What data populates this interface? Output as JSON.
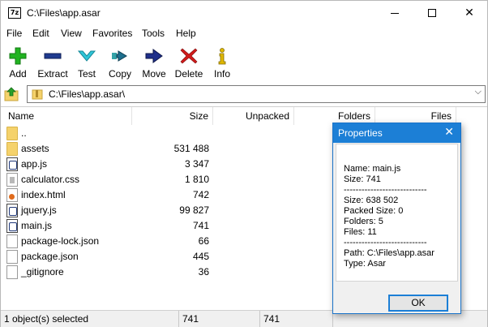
{
  "window": {
    "title": "C:\\Files\\app.asar",
    "app_icon_text": "7z"
  },
  "menu": [
    "File",
    "Edit",
    "View",
    "Favorites",
    "Tools",
    "Help"
  ],
  "toolbar": {
    "add": "Add",
    "extract": "Extract",
    "test": "Test",
    "copy": "Copy",
    "move": "Move",
    "delete": "Delete",
    "info": "Info"
  },
  "address": {
    "path": "C:\\Files\\app.asar\\"
  },
  "columns": {
    "name": "Name",
    "size": "Size",
    "unpacked": "Unpacked",
    "folders": "Folders",
    "files": "Files"
  },
  "rows": [
    {
      "name": "..",
      "size": "",
      "icon": "folder"
    },
    {
      "name": "assets",
      "size": "531 488",
      "icon": "folder"
    },
    {
      "name": "app.js",
      "size": "3 347",
      "icon": "script"
    },
    {
      "name": "calculator.css",
      "size": "1 810",
      "icon": "css"
    },
    {
      "name": "index.html",
      "size": "742",
      "icon": "html"
    },
    {
      "name": "jquery.js",
      "size": "99 827",
      "icon": "script"
    },
    {
      "name": "main.js",
      "size": "741",
      "icon": "script"
    },
    {
      "name": "package-lock.json",
      "size": "66",
      "icon": "file"
    },
    {
      "name": "package.json",
      "size": "445",
      "icon": "file"
    },
    {
      "name": "_gitignore",
      "size": "36",
      "icon": "file"
    }
  ],
  "status": {
    "selected": "1 object(s) selected",
    "size": "741",
    "packed": "741"
  },
  "properties": {
    "title": "Properties",
    "lines": [
      "Name: main.js",
      "Size: 741",
      "----------------------------",
      "Size: 638 502",
      "Packed Size: 0",
      "Folders: 5",
      "Files: 11",
      "----------------------------",
      "Path: C:\\Files\\app.asar",
      "Type: Asar"
    ],
    "ok": "OK"
  },
  "colors": {
    "dialog_title": "#1c7fd6",
    "add_icon": "#21b321",
    "extract_icon": "#1f3a8f",
    "delete_icon": "#d11b1b"
  }
}
